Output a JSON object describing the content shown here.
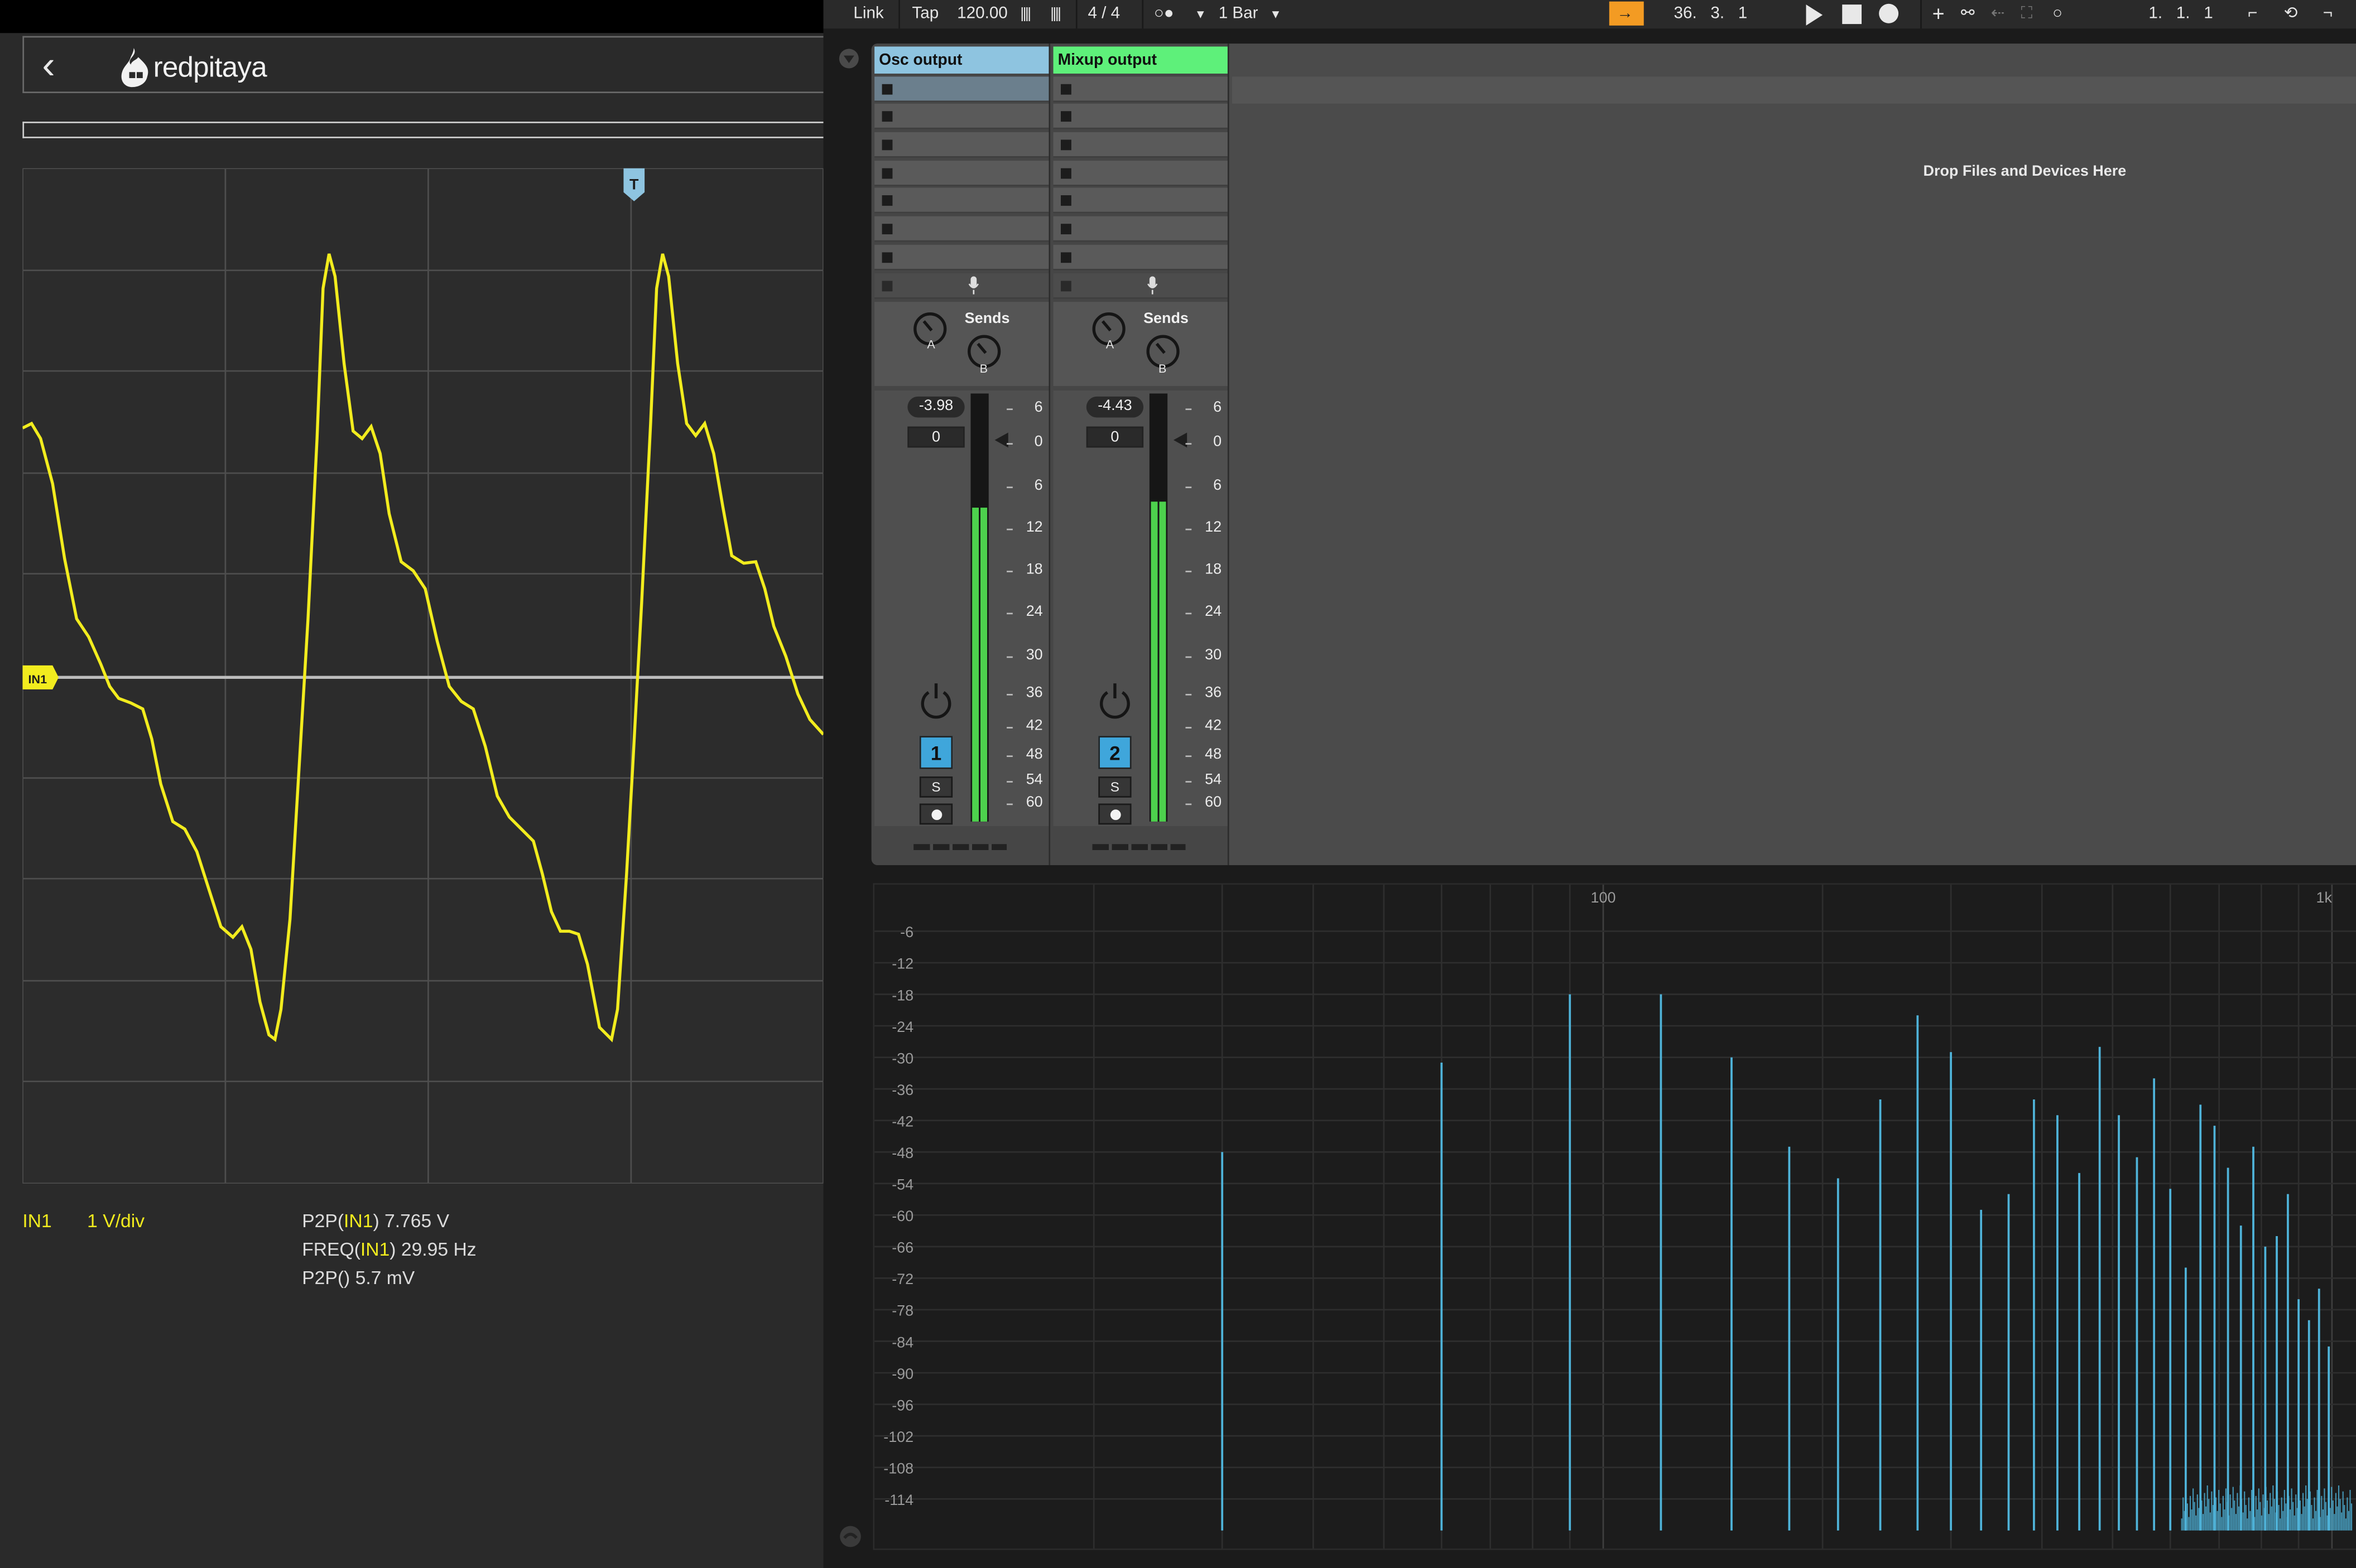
{
  "redpitaya": {
    "back_glyph": "‹",
    "logo_text": "redpitaya",
    "trigger_marker": "T",
    "channel_marker": "IN1",
    "channel": "IN1",
    "scale": "1 V/div",
    "measurements": {
      "p2p_prefix": "P2P(",
      "p2p_channel": "IN1",
      "p2p_suffix": ") 7.765 V",
      "freq_prefix": "FREQ(",
      "freq_channel": "IN1",
      "freq_suffix": ") 29.95 Hz",
      "p2p_empty": "P2P() 5.7 mV"
    },
    "colors": {
      "trace": "#f2ec1e",
      "marker_T": "#8ec4e0"
    }
  },
  "ableton": {
    "toolbar": {
      "link": "Link",
      "tap": "Tap",
      "tempo": "120.00",
      "signature": "4 / 4",
      "metronome": "○●",
      "quantize": "1 Bar",
      "position": "36.   3.   1",
      "loop_position": "1.   1.   1"
    },
    "drop_text": "Drop Files and Devices Here",
    "tracks": [
      {
        "name": "Osc output",
        "color": "#8ec4e0",
        "sends_label": "Sends",
        "send_a": "A",
        "send_b": "B",
        "volume": "-3.98",
        "pan": "0",
        "number": "1",
        "solo": "S"
      },
      {
        "name": "Mixup output",
        "color": "#5ef07a",
        "sends_label": "Sends",
        "send_a": "A",
        "send_b": "B",
        "volume": "-4.43",
        "pan": "0",
        "number": "2",
        "solo": "S"
      }
    ],
    "meter_scale": [
      "6",
      "0",
      "6",
      "12",
      "18",
      "24",
      "30",
      "36",
      "42",
      "48",
      "54",
      "60"
    ]
  },
  "chart_data": {
    "type": "bar",
    "title": "",
    "x_scale": "log",
    "x_tick_labels": [
      "100",
      "1k"
    ],
    "y_tick_labels": [
      "-6",
      "-12",
      "-18",
      "-24",
      "-30",
      "-36",
      "-42",
      "-48",
      "-54",
      "-60",
      "-66",
      "-72",
      "-78",
      "-84",
      "-90",
      "-96",
      "-102",
      "-108",
      "-114"
    ],
    "ylim": [
      -120,
      0
    ],
    "color": "#4fb3d9",
    "series": [
      {
        "x": [
          30,
          60,
          90,
          120,
          150,
          180,
          210,
          240,
          270,
          300,
          330,
          360,
          390,
          420,
          450,
          480,
          510,
          540,
          570,
          600,
          630,
          660,
          690,
          720,
          750,
          780,
          810,
          840,
          870,
          900,
          930,
          960,
          990
        ],
        "values": [
          -48,
          -31,
          -18,
          -18,
          -30,
          -47,
          -53,
          -38,
          -22,
          -29,
          -59,
          -56,
          -38,
          -41,
          -52,
          -28,
          -41,
          -49,
          -34,
          -55,
          -70,
          -39,
          -43,
          -51,
          -62,
          -47,
          -66,
          -64,
          -56,
          -76,
          -80,
          -74,
          -85
        ]
      }
    ]
  }
}
